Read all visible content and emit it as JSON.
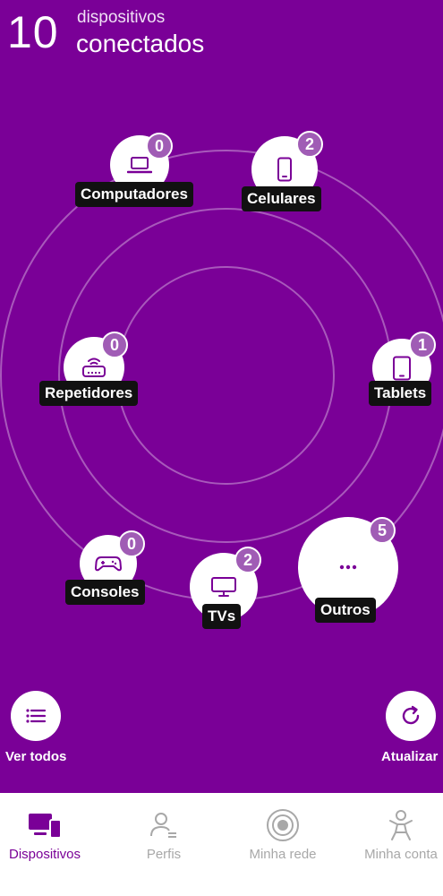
{
  "header": {
    "count": "10",
    "subtitle": "dispositivos",
    "title": "conectados"
  },
  "devices": {
    "computadores": {
      "label": "Computadores",
      "count": "0",
      "icon": "laptop-icon"
    },
    "celulares": {
      "label": "Celulares",
      "count": "2",
      "icon": "smartphone-icon"
    },
    "repetidores": {
      "label": "Repetidores",
      "count": "0",
      "icon": "router-icon"
    },
    "tablets": {
      "label": "Tablets",
      "count": "1",
      "icon": "tablet-icon"
    },
    "consoles": {
      "label": "Consoles",
      "count": "0",
      "icon": "gamepad-icon"
    },
    "tvs": {
      "label": "TVs",
      "count": "2",
      "icon": "monitor-icon"
    },
    "outros": {
      "label": "Outros",
      "count": "5",
      "icon": "more-icon"
    }
  },
  "actions": {
    "ver_todos": "Ver todos",
    "atualizar": "Atualizar"
  },
  "nav": {
    "dispositivos": "Dispositivos",
    "perfis": "Perfis",
    "minha_rede": "Minha rede",
    "minha_conta": "Minha conta"
  },
  "colors": {
    "primary": "#7a0097",
    "badge": "#a05cb5",
    "label_bg": "#111111",
    "nav_inactive": "#a8a8a8"
  }
}
